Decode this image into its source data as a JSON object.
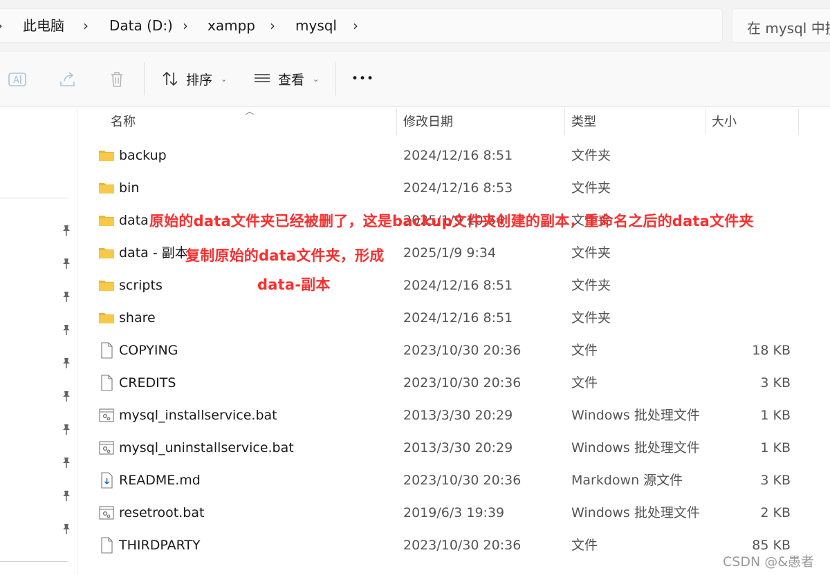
{
  "breadcrumb": {
    "items": [
      "此电脑",
      "Data (D:)",
      "xampp",
      "mysql"
    ],
    "separator": "›"
  },
  "search": {
    "placeholder": "在 mysql 中搜"
  },
  "toolbar": {
    "sort_label": "排序",
    "view_label": "查看",
    "more_label": "•••"
  },
  "columns": {
    "name": "名称",
    "modified": "修改日期",
    "type": "类型",
    "size": "大小"
  },
  "files": [
    {
      "name": "backup",
      "modified": "2024/12/16 8:51",
      "type": "文件夹",
      "size": "",
      "icon": "folder-icon"
    },
    {
      "name": "bin",
      "modified": "2024/12/16 8:53",
      "type": "文件夹",
      "size": "",
      "icon": "folder-icon"
    },
    {
      "name": "data",
      "modified": "2025/1/9 10:54",
      "type": "文件夹",
      "size": "",
      "icon": "folder-icon"
    },
    {
      "name": "data - 副本",
      "modified": "2025/1/9 9:34",
      "type": "文件夹",
      "size": "",
      "icon": "folder-icon"
    },
    {
      "name": "scripts",
      "modified": "2024/12/16 8:51",
      "type": "文件夹",
      "size": "",
      "icon": "folder-icon"
    },
    {
      "name": "share",
      "modified": "2024/12/16 8:51",
      "type": "文件夹",
      "size": "",
      "icon": "folder-icon"
    },
    {
      "name": "COPYING",
      "modified": "2023/10/30 20:36",
      "type": "文件",
      "size": "18 KB",
      "icon": "file-icon"
    },
    {
      "name": "CREDITS",
      "modified": "2023/10/30 20:36",
      "type": "文件",
      "size": "3 KB",
      "icon": "file-icon"
    },
    {
      "name": "mysql_installservice.bat",
      "modified": "2013/3/30 20:29",
      "type": "Windows 批处理文件",
      "size": "1 KB",
      "icon": "batch-file-icon"
    },
    {
      "name": "mysql_uninstallservice.bat",
      "modified": "2013/3/30 20:29",
      "type": "Windows 批处理文件",
      "size": "1 KB",
      "icon": "batch-file-icon"
    },
    {
      "name": "README.md",
      "modified": "2023/10/30 20:36",
      "type": "Markdown 源文件",
      "size": "3 KB",
      "icon": "markdown-file-icon"
    },
    {
      "name": "resetroot.bat",
      "modified": "2019/6/3 19:39",
      "type": "Windows 批处理文件",
      "size": "2 KB",
      "icon": "batch-file-icon"
    },
    {
      "name": "THIRDPARTY",
      "modified": "2023/10/30 20:36",
      "type": "文件",
      "size": "85 KB",
      "icon": "file-icon"
    }
  ],
  "annotations": {
    "data_note": "原始的data文件夹已经被删了，这是backup文件夹创建的副本，重命名之后的data文件夹",
    "copy_note_line1": "复制原始的data文件夹，形成",
    "copy_note_line2": "data-副本"
  },
  "watermark": "CSDN @&愚者",
  "colors": {
    "annotation": "#ff2d2d",
    "folder": "#f8c949",
    "accent": "#0067c0"
  }
}
